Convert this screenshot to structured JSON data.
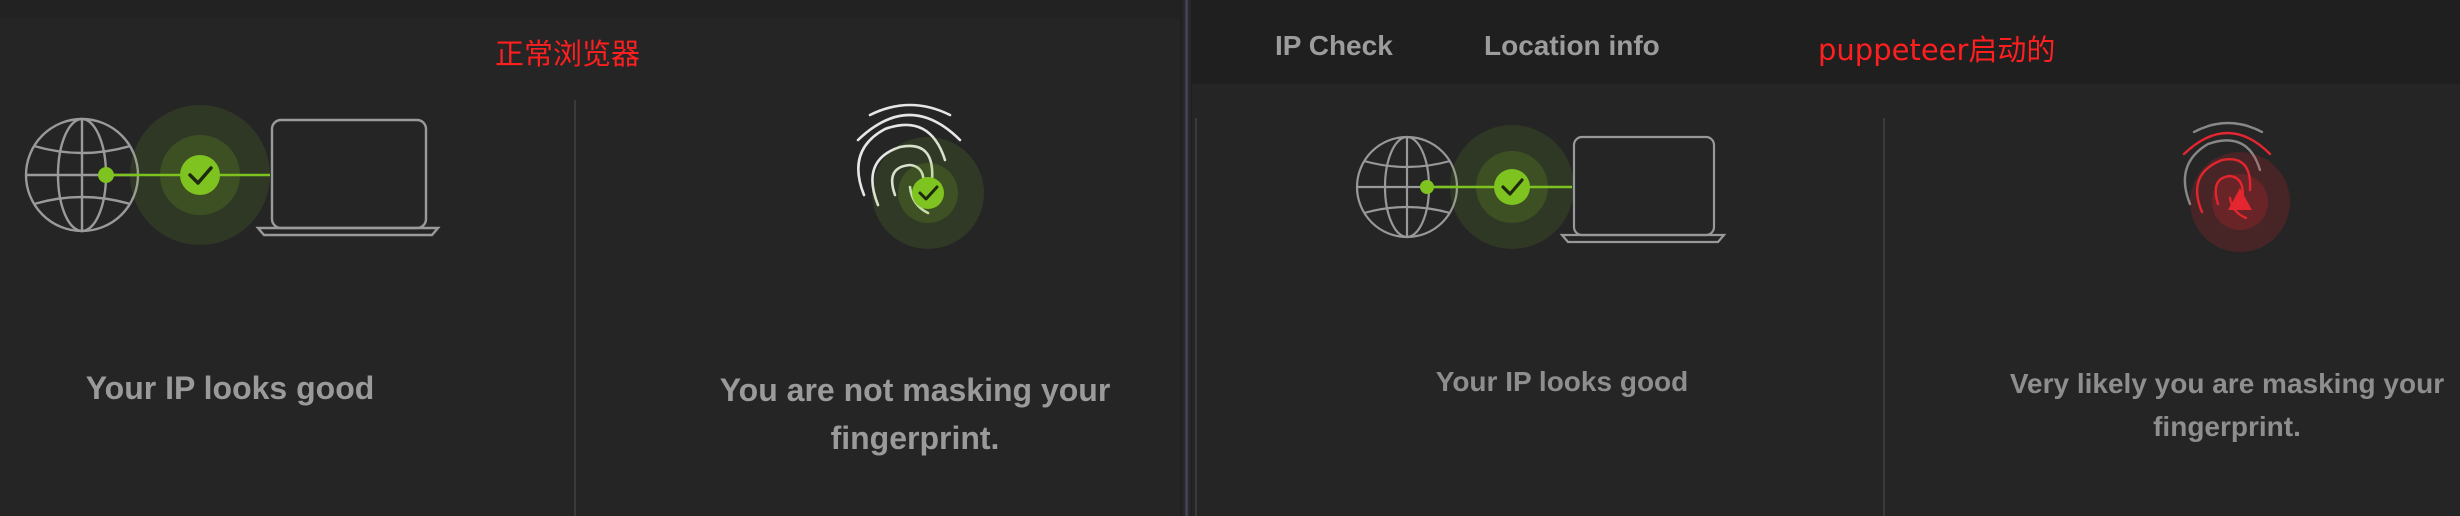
{
  "left": {
    "annotation": "正常浏览器",
    "ip_status": "Your IP looks good",
    "fingerprint_status_line1": "You are not masking your",
    "fingerprint_status_line2": "fingerprint.",
    "icons": [
      "globe-icon",
      "shield-check-icon",
      "laptop-icon",
      "fingerprint-icon",
      "check-badge-icon"
    ]
  },
  "right": {
    "tabs": [
      "IP Check",
      "Location info"
    ],
    "annotation": "puppeteer启动的",
    "ip_status": "Your IP looks good",
    "fingerprint_status_line1": "Very likely you are masking your",
    "fingerprint_status_line2": "fingerprint.",
    "icons": [
      "globe-icon",
      "shield-check-icon",
      "laptop-icon",
      "fingerprint-icon",
      "warning-triangle-icon"
    ]
  },
  "colors": {
    "good": "#7ec31f",
    "bad": "#e3262f",
    "annotation": "#ff1f1f",
    "background": "#252526",
    "line": "#9a9a9a"
  }
}
